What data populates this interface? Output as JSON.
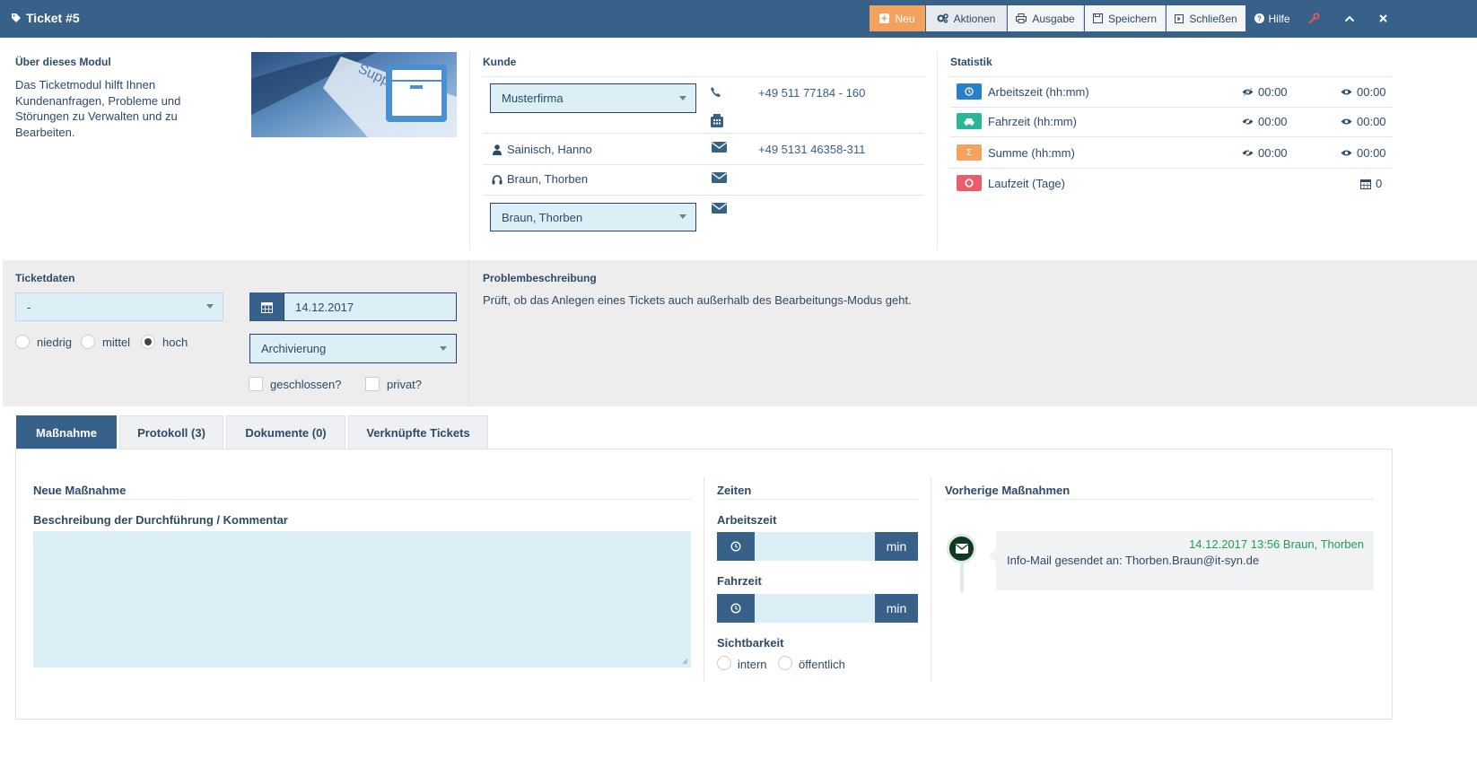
{
  "header": {
    "title": "Ticket #5",
    "buttons": {
      "new": "Neu",
      "actions": "Aktionen",
      "output": "Ausgabe",
      "save": "Speichern",
      "close": "Schließen",
      "help": "Hilfe"
    }
  },
  "about": {
    "title": "Über dieses Modul",
    "text": "Das Ticketmodul hilft Ihnen Kundenanfragen, Probleme und Störungen zu Verwalten und zu Bearbeiten."
  },
  "customer": {
    "title": "Kunde",
    "company": "Musterfirma",
    "phone": "+49 511 77184 - 160",
    "contact": "Sainisch, Hanno",
    "contact_phone": "+49 5131 46358-311",
    "agent": "Braun, Thorben",
    "assignee": "Braun, Thorben"
  },
  "statistics": {
    "title": "Statistik",
    "rows": [
      {
        "label": "Arbeitszeit (hh:mm)",
        "v1": "00:00",
        "v2": "00:00",
        "color": "#2a7fc9"
      },
      {
        "label": "Fahrzeit (hh:mm)",
        "v1": "00:00",
        "v2": "00:00",
        "color": "#2bb69a"
      },
      {
        "label": "Summe (hh:mm)",
        "v1": "00:00",
        "v2": "00:00",
        "color": "#f5a25d",
        "symbol": "Σ"
      },
      {
        "label": "Laufzeit (Tage)",
        "v2": "0",
        "color": "#ea5d6a"
      }
    ]
  },
  "ticketdata": {
    "title": "Ticketdaten",
    "select_value": "-",
    "date": "14.12.2017",
    "category": "Archivierung",
    "priority": {
      "low": "niedrig",
      "mid": "mittel",
      "high": "hoch",
      "selected": "hoch"
    },
    "closed_label": "geschlossen?",
    "private_label": "privat?"
  },
  "problem": {
    "title": "Problembeschreibung",
    "text": "Prüft, ob das Anlegen eines Tickets auch außerhalb des Bearbeitungs-Modus geht."
  },
  "tabs": [
    {
      "label": "Maßnahme",
      "active": true
    },
    {
      "label": "Protokoll (3)"
    },
    {
      "label": "Dokumente (0)"
    },
    {
      "label": "Verknüpfte Tickets"
    }
  ],
  "measure": {
    "title": "Neue Maßnahme",
    "desc_label": "Beschreibung der Durchführung / Kommentar"
  },
  "times": {
    "title": "Zeiten",
    "work_label": "Arbeitszeit",
    "travel_label": "Fahrzeit",
    "unit": "min",
    "visibility_label": "Sichtbarkeit",
    "intern": "intern",
    "public": "öffentlich"
  },
  "previous": {
    "title": "Vorherige Maßnahmen",
    "entries": [
      {
        "meta": "14.12.2017 13:56 Braun, Thorben",
        "text": "Info-Mail gesendet an: Thorben.Braun@it-syn.de"
      }
    ]
  },
  "colors": {
    "primary": "#376188",
    "accent_orange": "#f2a25c",
    "input_bg": "#dceff7",
    "timeline_green": "#1f9d55"
  }
}
